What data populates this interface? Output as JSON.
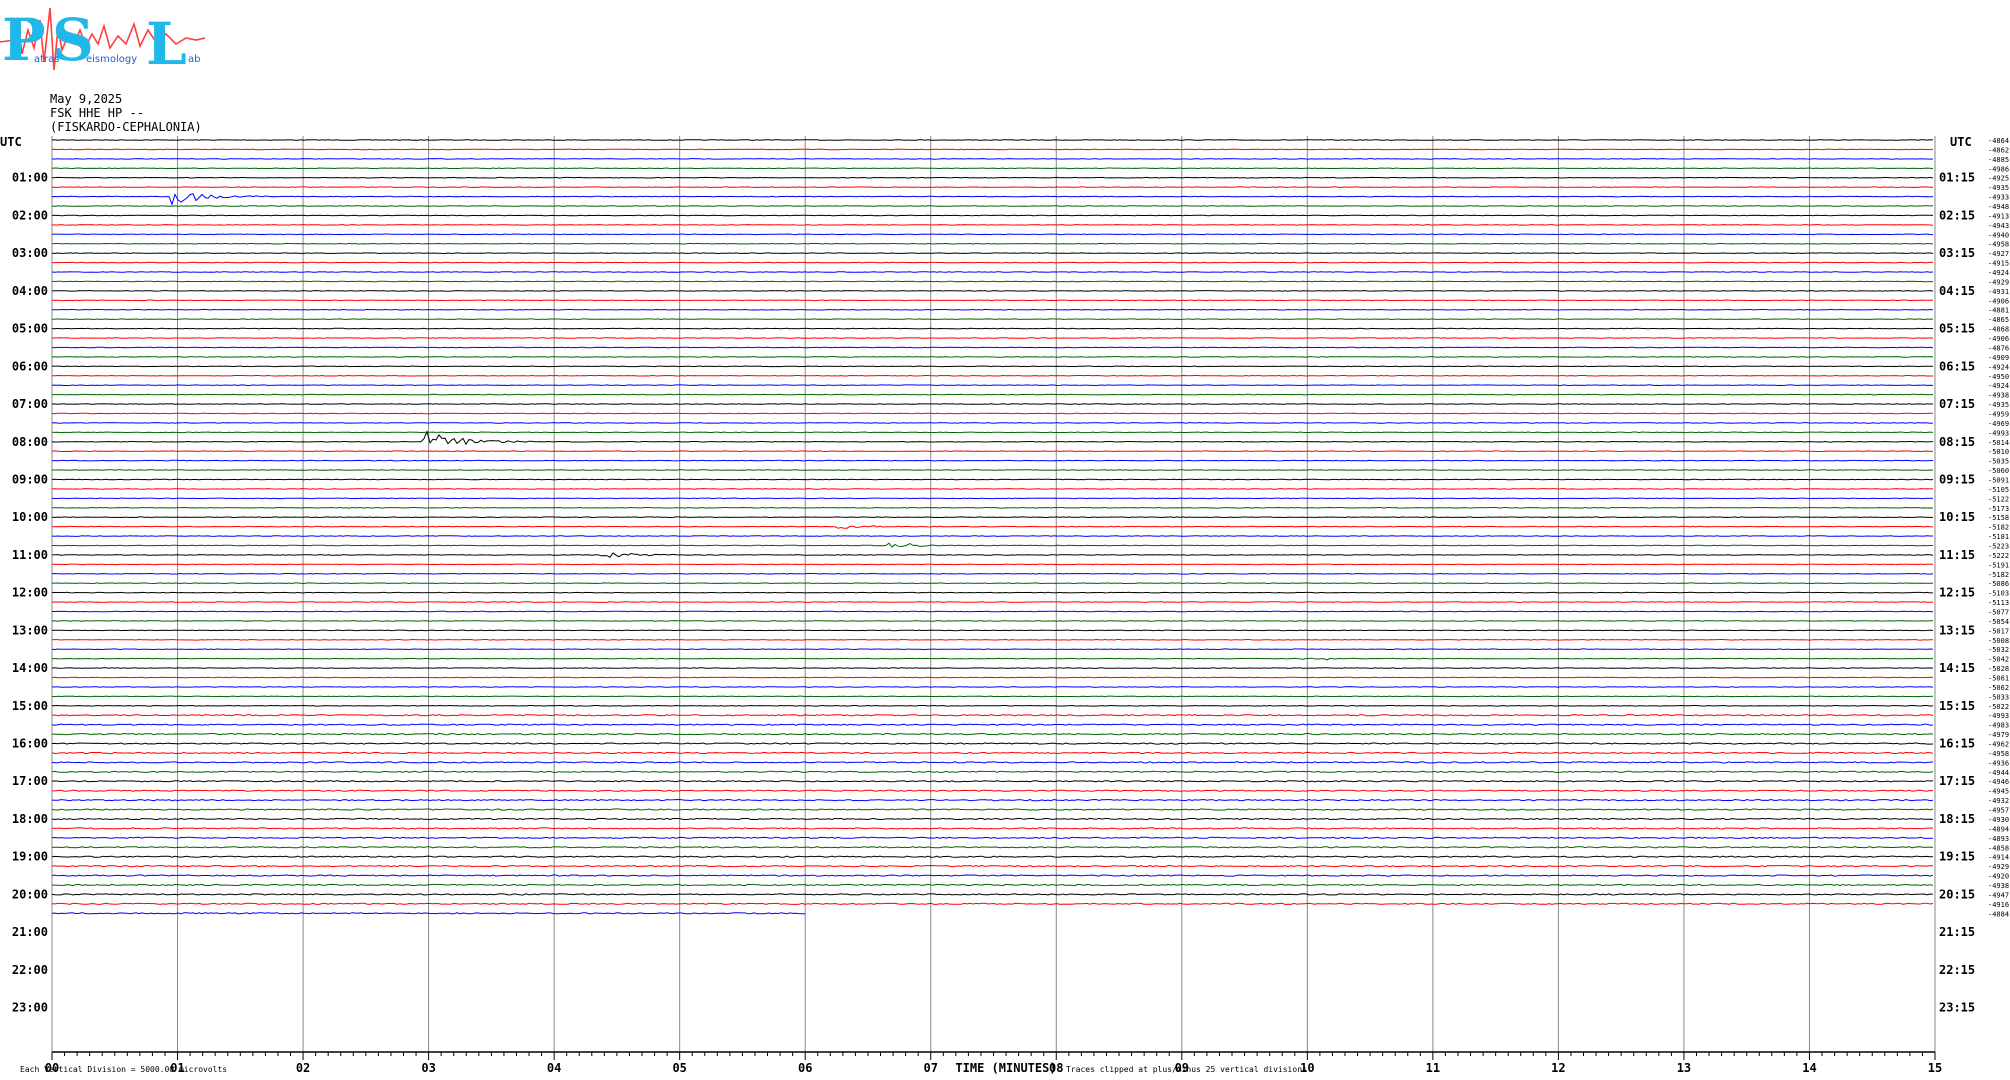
{
  "logo": {
    "letters": [
      "P",
      "S",
      "L"
    ],
    "words": [
      "atras",
      "eismology",
      "ab"
    ]
  },
  "header": {
    "date": "May 9,2025",
    "channel": "FSK HHE HP --",
    "station": "(FISKARDO-CEPHALONIA)"
  },
  "chart_data": {
    "type": "line",
    "title": "",
    "xlabel": "TIME (MINUTES)",
    "xlim": [
      0,
      15
    ],
    "x_tick_labels": [
      "00",
      "01",
      "02",
      "03",
      "04",
      "05",
      "06",
      "07",
      "08",
      "09",
      "10",
      "11",
      "12",
      "13",
      "14",
      "15"
    ],
    "left_axis_label": "UTC",
    "right_axis_label": "UTC",
    "left_hour_labels": [
      "01:00",
      "02:00",
      "03:00",
      "04:00",
      "05:00",
      "06:00",
      "07:00",
      "08:00",
      "09:00",
      "10:00",
      "11:00",
      "12:00",
      "13:00",
      "14:00",
      "15:00",
      "16:00",
      "17:00",
      "18:00",
      "19:00",
      "20:00",
      "21:00",
      "22:00",
      "23:00"
    ],
    "right_hour_labels": [
      "01:15",
      "02:15",
      "03:15",
      "04:15",
      "05:15",
      "06:15",
      "07:15",
      "08:15",
      "09:15",
      "10:15",
      "11:15",
      "12:15",
      "13:15",
      "14:15",
      "15:15",
      "16:15",
      "17:15",
      "18:15",
      "19:15",
      "20:15",
      "21:15",
      "22:15",
      "23:15"
    ],
    "row_minutes": 15,
    "rows_recorded": 83,
    "last_row_end_minute": 6,
    "trace_colors": [
      "#000000",
      "#ff0000",
      "#0000ff",
      "#006400"
    ],
    "grid_color": "#888888",
    "trace_offsets": [
      "4864",
      "4862",
      "4885",
      "4986",
      "4925",
      "4935",
      "4933",
      "4948",
      "4913",
      "4943",
      "4940",
      "4958",
      "4927",
      "4915",
      "4924",
      "4929",
      "4931",
      "4906",
      "4881",
      "4865",
      "4868",
      "4906",
      "4876",
      "4909",
      "4924",
      "4950",
      "4924",
      "4938",
      "4935",
      "4959",
      "4969",
      "4993",
      "5014",
      "5010",
      "5035",
      "5060",
      "5091",
      "5105",
      "5122",
      "5173",
      "5158",
      "5182",
      "5181",
      "5223",
      "5222",
      "5191",
      "5182",
      "5086",
      "5103",
      "5113",
      "5077",
      "5054",
      "5017",
      "5008",
      "5032",
      "5042",
      "5028",
      "5061",
      "5062",
      "5033",
      "5022",
      "4993",
      "4983",
      "4979",
      "4962",
      "4958",
      "4936",
      "4944",
      "4946",
      "4945",
      "4932",
      "4957",
      "4930",
      "4894",
      "4893",
      "4858",
      "4914",
      "4929",
      "4920",
      "4938",
      "4947",
      "4916",
      "4884"
    ],
    "events": [
      {
        "row": 6,
        "minute": 1.0,
        "amplitude": 7
      },
      {
        "row": 32,
        "minute": 3.0,
        "amplitude": 10
      },
      {
        "row": 41,
        "minute": 6.3,
        "amplitude": 2
      },
      {
        "row": 43,
        "minute": 6.7,
        "amplitude": 3
      },
      {
        "row": 44,
        "minute": 4.4,
        "amplitude": 3
      },
      {
        "row": 55,
        "minute": 10.0,
        "amplitude": 2
      }
    ],
    "footer_left": "Each Vertical Division = 5000.00 microvolts",
    "footer_right": "Traces clipped at plus/minus 25 vertical divisions"
  }
}
